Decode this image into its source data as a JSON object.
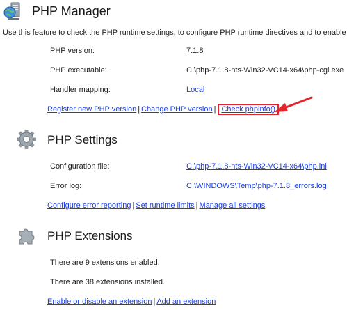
{
  "header": {
    "title": "PHP Manager",
    "description": "Use this feature to check the PHP runtime settings, to configure PHP runtime directives and to enable"
  },
  "runtime": {
    "rows": [
      {
        "label": "PHP version:",
        "value": "7.1.8",
        "is_link": false
      },
      {
        "label": "PHP executable:",
        "value": "C:\\php-7.1.8-nts-Win32-VC14-x64\\php-cgi.exe",
        "is_link": false
      },
      {
        "label": "Handler mapping:",
        "value": "Local",
        "is_link": true
      }
    ],
    "links": {
      "register": "Register new PHP version",
      "change": "Change PHP version",
      "check": "Check phpinfo()"
    },
    "separator": "|"
  },
  "settings": {
    "title": "PHP Settings",
    "rows": [
      {
        "label": "Configuration file:",
        "value": "C:\\php-7.1.8-nts-Win32-VC14-x64\\php.ini"
      },
      {
        "label": "Error log:",
        "value": "C:\\WINDOWS\\Temp\\php-7.1.8_errors.log"
      }
    ],
    "links": {
      "error_reporting": "Configure error reporting",
      "runtime_limits": "Set runtime limits",
      "manage_all": "Manage all settings"
    }
  },
  "extensions": {
    "title": "PHP Extensions",
    "enabled_text": "There are 9 extensions enabled.",
    "installed_text": "There are 38 extensions installed.",
    "links": {
      "enable_disable": "Enable or disable an extension",
      "add": "Add an extension"
    }
  },
  "colors": {
    "link": "#1a3ee0",
    "highlight": "#e3242b",
    "text": "#1e1e1e"
  },
  "icons": {
    "title": "php-manager-icon",
    "settings": "gear-icon",
    "extensions": "puzzle-icon",
    "annotation": "red-arrow"
  }
}
